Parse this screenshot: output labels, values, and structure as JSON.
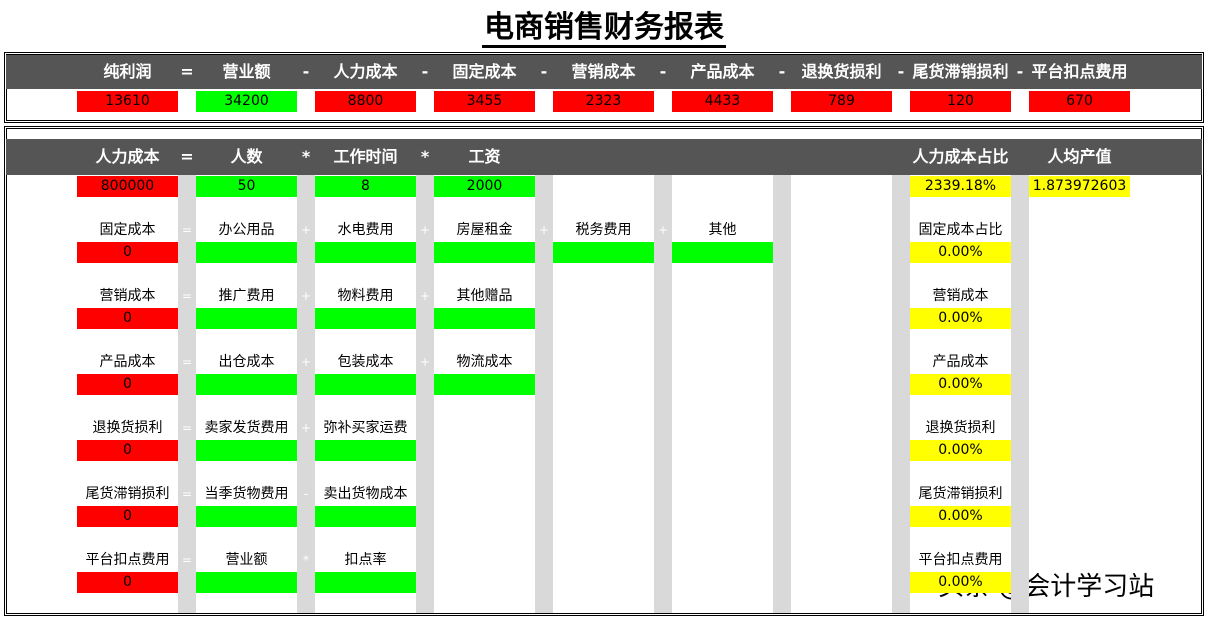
{
  "title": "电商销售财务报表",
  "top": {
    "labels": [
      "纯利润",
      "营业额",
      "人力成本",
      "固定成本",
      "营销成本",
      "产品成本",
      "退换货损利",
      "尾货滞销损利",
      "平台扣点费用"
    ],
    "ops": [
      "=",
      "-",
      "-",
      "-",
      "-",
      "-",
      "-",
      "-"
    ],
    "values": [
      "13610",
      "34200",
      "8800",
      "3455",
      "2323",
      "4433",
      "789",
      "120",
      "670"
    ]
  },
  "labor": {
    "labels": [
      "人力成本",
      "人数",
      "工作时间",
      "工资"
    ],
    "ops": [
      "=",
      "*",
      "*"
    ],
    "values": [
      "800000",
      "50",
      "8",
      "2000"
    ],
    "ratio_label": "人力成本占比",
    "ratio_value": "2339.18%",
    "per_capita_label": "人均产值",
    "per_capita_value": "1.873972603"
  },
  "rows": [
    {
      "name": "固定成本",
      "value": "0",
      "items": [
        "办公用品",
        "水电费用",
        "房屋租金",
        "税务费用",
        "其他"
      ],
      "ops": [
        "=",
        "+",
        "+",
        "+",
        "+"
      ],
      "ratio_label": "固定成本占比",
      "ratio_value": "0.00%"
    },
    {
      "name": "营销成本",
      "value": "0",
      "items": [
        "推广费用",
        "物料费用",
        "其他赠品"
      ],
      "ops": [
        "=",
        "+",
        "+"
      ],
      "ratio_label": "营销成本",
      "ratio_value": "0.00%"
    },
    {
      "name": "产品成本",
      "value": "0",
      "items": [
        "出仓成本",
        "包装成本",
        "物流成本"
      ],
      "ops": [
        "=",
        "+",
        "+"
      ],
      "ratio_label": "产品成本",
      "ratio_value": "0.00%"
    },
    {
      "name": "退换货损利",
      "value": "0",
      "items": [
        "卖家发货费用",
        "弥补买家运费"
      ],
      "ops": [
        "=",
        "+"
      ],
      "ratio_label": "退换货损利",
      "ratio_value": "0.00%"
    },
    {
      "name": "尾货滞销损利",
      "value": "0",
      "items": [
        "当季货物费用",
        "卖出货物成本"
      ],
      "ops": [
        "=",
        "-"
      ],
      "ratio_label": "尾货滞销损利",
      "ratio_value": "0.00%"
    },
    {
      "name": "平台扣点费用",
      "value": "0",
      "items": [
        "营业额",
        "扣点率"
      ],
      "ops": [
        "=",
        "*"
      ],
      "ratio_label": "平台扣点费用",
      "ratio_value": "0.00%"
    }
  ],
  "watermark": "头条 @会计学习站",
  "colors": {
    "header_bg": "#555555",
    "red": "#ff0000",
    "green": "#00ff00",
    "yellow": "#ffff00",
    "gray": "#d9d9d9"
  }
}
